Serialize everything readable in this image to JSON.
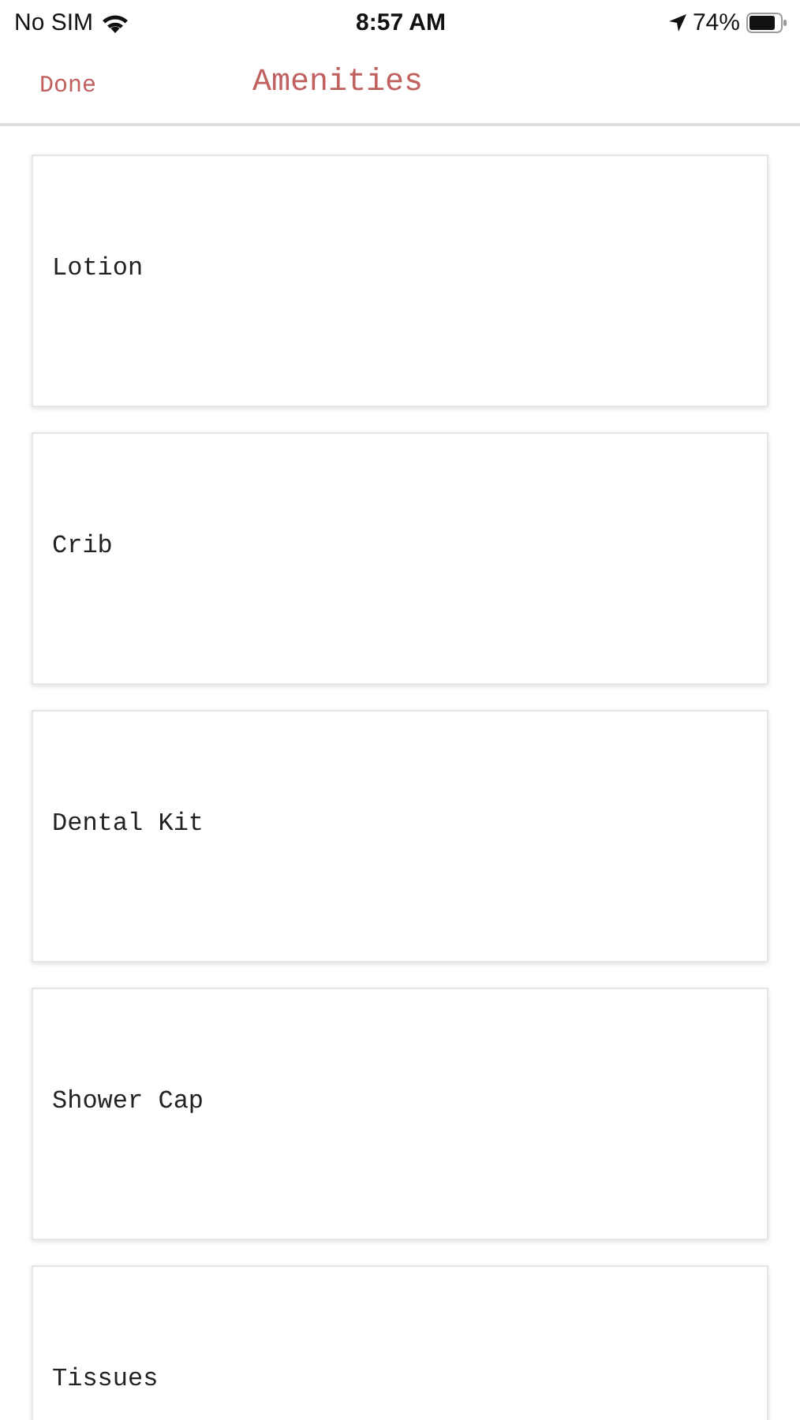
{
  "status_bar": {
    "carrier": "No SIM",
    "time": "8:57 AM",
    "battery": "74%"
  },
  "nav": {
    "done": "Done",
    "title": "Amenities"
  },
  "items": [
    {
      "label": "Lotion"
    },
    {
      "label": "Crib"
    },
    {
      "label": "Dental Kit"
    },
    {
      "label": "Shower Cap"
    },
    {
      "label": "Tissues"
    }
  ]
}
